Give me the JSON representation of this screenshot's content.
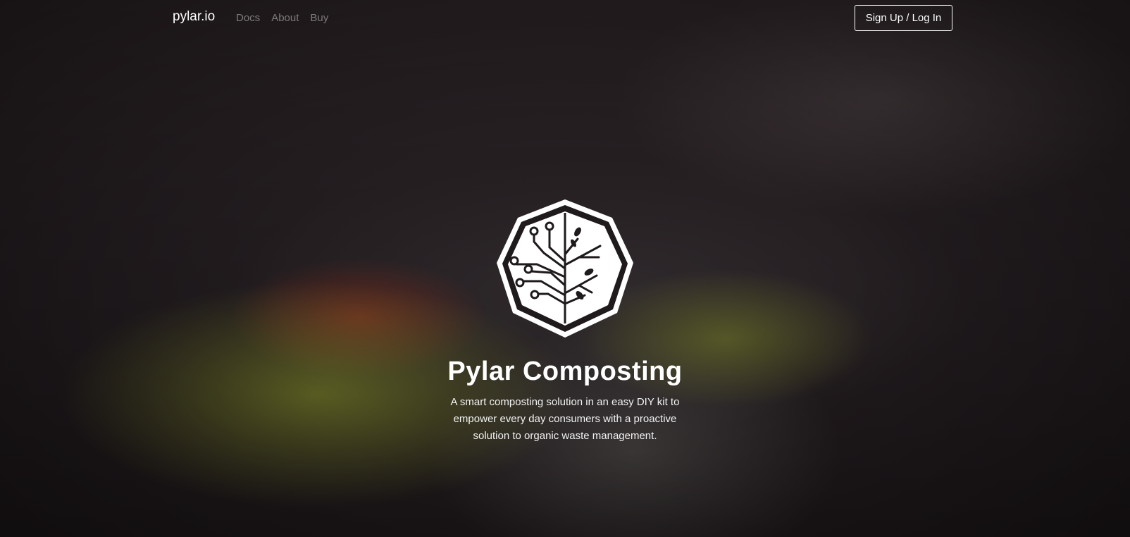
{
  "nav": {
    "brand": "pylar.io",
    "links": [
      "Docs",
      "About",
      "Buy"
    ],
    "signup_label": "Sign Up / Log In"
  },
  "hero": {
    "title": "Pylar Composting",
    "tagline": "A smart composting solution in an easy DIY kit to empower every day consumers with a proactive solution to organic waste management.",
    "logo_icon": "pylar-circuit-tree-logo"
  }
}
